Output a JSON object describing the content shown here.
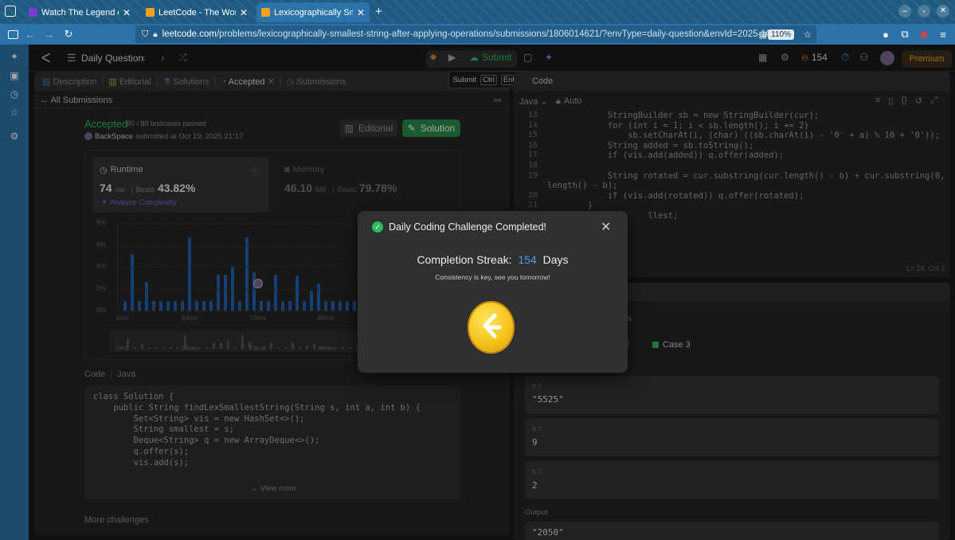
{
  "browser": {
    "tabs": [
      {
        "title": "Watch The Legend of Hang",
        "active": false,
        "favicon_color": "#7a3fcf"
      },
      {
        "title": "LeetCode - The World's Lea",
        "active": false,
        "favicon_color": "#f89f1b"
      },
      {
        "title": "Lexicographically Smallest",
        "active": true,
        "favicon_color": "#f89f1b"
      }
    ],
    "url_host": "leetcode.com",
    "url_path": "/problems/lexicographically-smallest-string-after-applying-operations/submissions/1806014621/?envType=daily-question&envId=2025-10-19",
    "zoom": "110%"
  },
  "lc_header": {
    "daily_question": "Daily Question",
    "submit_label": "Submit",
    "streak": "154",
    "premium": "Premium",
    "tooltip": {
      "label": "Submit",
      "key1": "Ctrl",
      "key2": "Enter"
    }
  },
  "left_tabs": [
    "Description",
    "Editorial",
    "Solutions",
    "Accepted",
    "Submissions"
  ],
  "submission": {
    "back_label": "All Submissions",
    "status": "Accepted",
    "testcases": "80 / 80 testcases passed",
    "user": "BackSpace",
    "submitted_at": "submitted at Oct 19, 2025 21:17",
    "editorial_btn": "Editorial",
    "solution_btn": "Solution",
    "runtime_label": "Runtime",
    "runtime_value": "74",
    "runtime_unit": "ms",
    "runtime_beats_label": "Beats",
    "runtime_beats": "43.82%",
    "analyze": "Analyze Complexity",
    "memory_label": "Memory",
    "memory_value": "46.10",
    "memory_unit": "MB",
    "memory_beats_label": "Beats",
    "memory_beats": "79.78%"
  },
  "chart_data": {
    "type": "bar",
    "y_ticks": [
      "8%",
      "6%",
      "4%",
      "2%",
      "0%"
    ],
    "x_ticks": [
      "1ms",
      "64ms",
      "74ms",
      "88ms"
    ],
    "ylim": [
      0,
      8
    ],
    "values": [
      0.9,
      5.2,
      0.9,
      2.6,
      0.9,
      0.9,
      0.9,
      0.9,
      0.9,
      6.7,
      0.9,
      0.9,
      0.9,
      3.3,
      3.3,
      4.0,
      0.9,
      6.7,
      3.5,
      0.9,
      0.9,
      3.3,
      0.9,
      0.9,
      3.2,
      0.9,
      1.8,
      2.5,
      0.9,
      0.9,
      0.9,
      0.9,
      0.9,
      0.9,
      0.9,
      0.9,
      0.9,
      0.9
    ]
  },
  "code_section": {
    "label": "Code",
    "lang": "Java",
    "view_more": "View more",
    "more_challenges": "More challenges",
    "lines": [
      "class Solution {",
      "    public String findLexSmallestString(String s, int a, int b) {",
      "        Set<String> vis = new HashSet<>();",
      "        String smallest = s;",
      "        Deque<String> q = new ArrayDeque<>();",
      "        q.offer(s);",
      "        vis.add(s);"
    ]
  },
  "editor": {
    "header": "Code",
    "lang": "Java",
    "mode": "Auto",
    "status": "Ln 24, Col 2",
    "lines": [
      {
        "n": "13",
        "t": "            StringBuilder sb = new StringBuilder(cur);"
      },
      {
        "n": "14",
        "t": "            for (int i = 1; i < sb.length(); i += 2)"
      },
      {
        "n": "15",
        "t": "                sb.setCharAt(i, (char) ((sb.charAt(i) - '0' + a) % 10 + '0'));"
      },
      {
        "n": "16",
        "t": "            String added = sb.toString();"
      },
      {
        "n": "17",
        "t": "            if (vis.add(added)) q.offer(added);"
      },
      {
        "n": "18",
        "t": ""
      },
      {
        "n": "19",
        "t": "            String rotated = cur.substring(cur.length() - b) + cur.substring(0, cur."
      },
      {
        "n": "",
        "t": "length() - b);"
      },
      {
        "n": "20",
        "t": "            if (vis.add(rotated)) q.offer(rotated);"
      },
      {
        "n": "21",
        "t": "        }"
      },
      {
        "n": "",
        "t": "                    llest;"
      }
    ]
  },
  "testcase": {
    "partial_label": "s",
    "case_label": "Case 3",
    "inputs": [
      {
        "name": "s =",
        "value": "\"5525\""
      },
      {
        "name": "a =",
        "value": "9"
      },
      {
        "name": "b =",
        "value": "2"
      }
    ],
    "output_label": "Output",
    "output_value": "\"2050\""
  },
  "modal": {
    "title": "Daily Coding Challenge Completed!",
    "streak_label": "Completion Streak:",
    "streak_value": "154",
    "streak_unit": "Days",
    "subtitle": "Consistency is key, see you tomorrow!"
  },
  "colors": {
    "accent_green": "#2cbb5d",
    "accent_blue": "#3b82f6",
    "browser_blue": "#2b73a8",
    "gold": "#f5c21b"
  }
}
